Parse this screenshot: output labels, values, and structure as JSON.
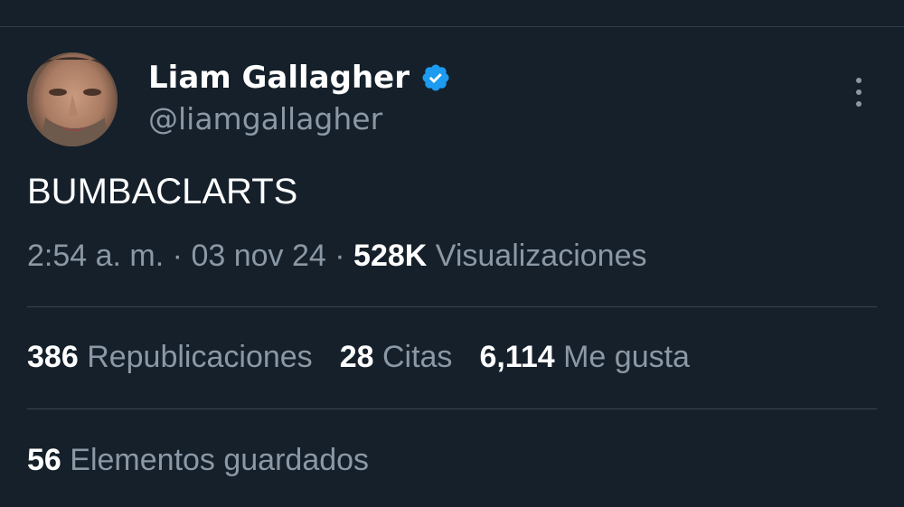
{
  "colors": {
    "background": "#15202b",
    "primary_text": "#ffffff",
    "secondary_text": "#8b98a5",
    "divider": "#38444d",
    "verified": "#1d9bf0"
  },
  "author": {
    "display_name": "Liam Gallagher",
    "handle": "@liamgallagher",
    "verified": true,
    "avatar_icon": "avatar-photo"
  },
  "tweet": {
    "text": "BUMBACLARTS",
    "time": "2:54 a. m.",
    "separator": "·",
    "date": "03 nov 24",
    "views_count": "528K",
    "views_label": "Visualizaciones"
  },
  "stats": {
    "reposts_count": "386",
    "reposts_label": "Republicaciones",
    "quotes_count": "28",
    "quotes_label": "Citas",
    "likes_count": "6,114",
    "likes_label": "Me gusta",
    "bookmarks_count": "56",
    "bookmarks_label": "Elementos guardados"
  },
  "icons": {
    "more": "more-options-icon",
    "verified": "verified-badge-icon"
  }
}
